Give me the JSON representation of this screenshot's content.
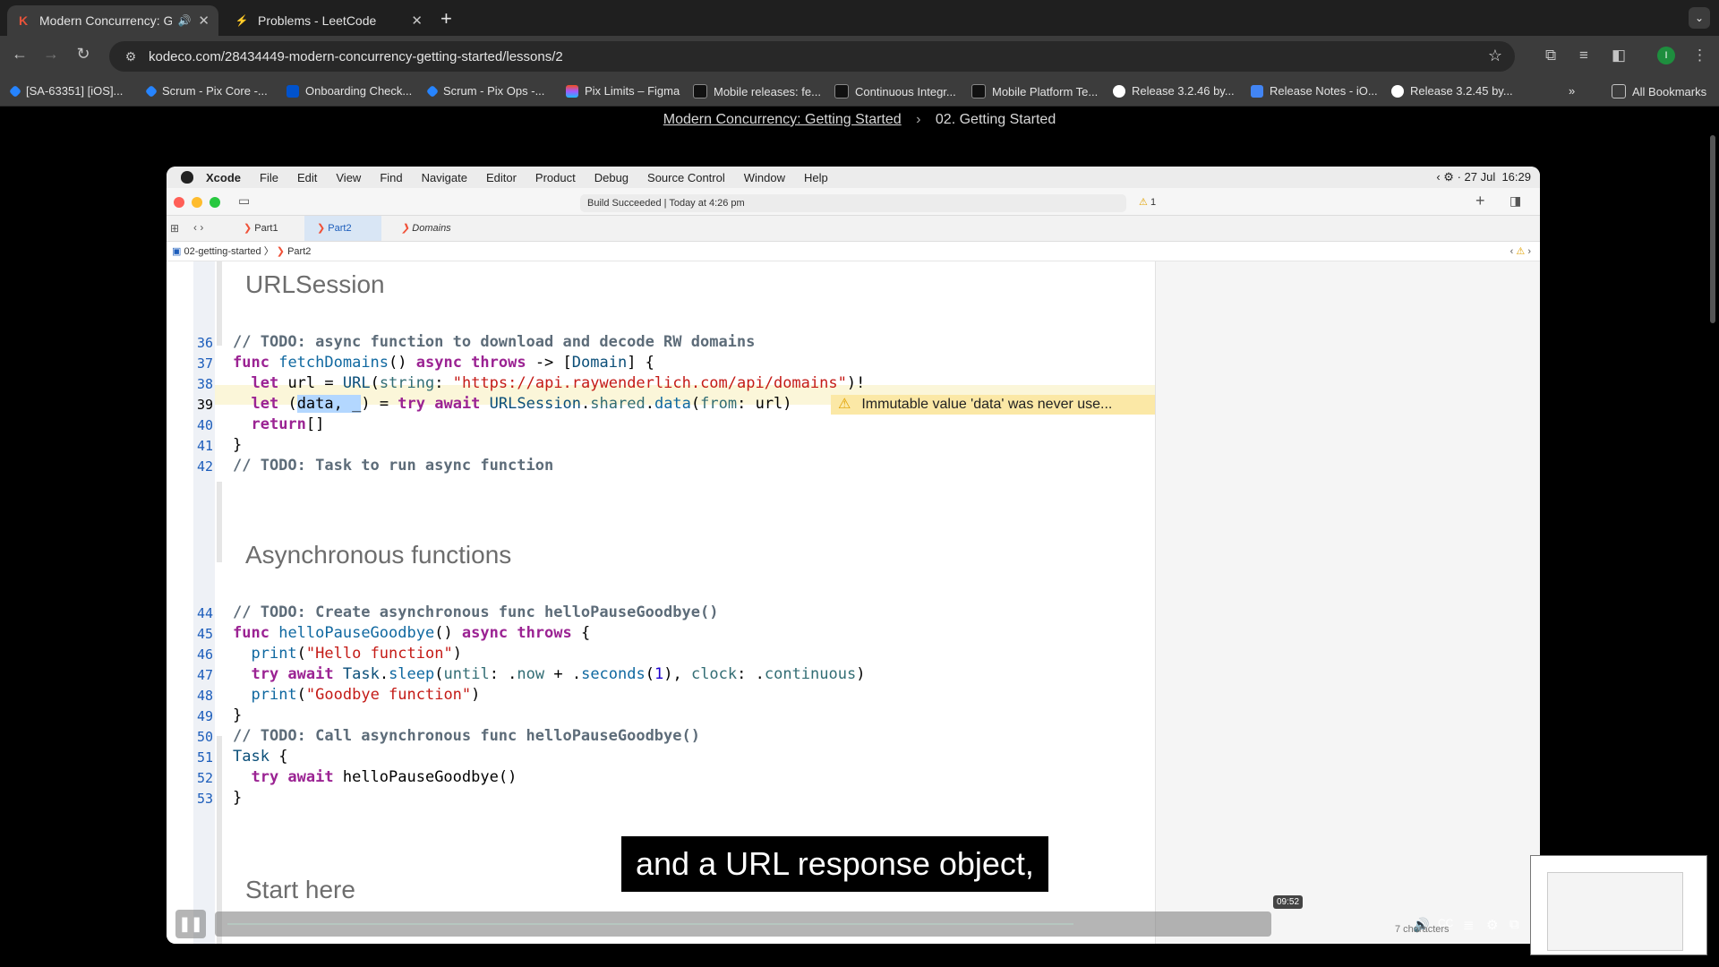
{
  "browser": {
    "tabs": [
      {
        "title": "Modern Concurrency: Getting Started",
        "favicon": "K"
      },
      {
        "title": "Problems - LeetCode",
        "favicon": "⚡"
      }
    ],
    "url": "kodeco.com/28434449-modern-concurrency-getting-started/lessons/2",
    "bookmarks": [
      "[SA-63351] [iOS]...",
      "Scrum - Pix Core -...",
      "Onboarding Check...",
      "Scrum - Pix Ops -...",
      "Pix Limits – Figma",
      "Mobile releases: fe...",
      "Continuous Integr...",
      "Mobile Platform Te...",
      "Release 3.2.46 by...",
      "Release Notes - iO...",
      "Release 3.2.45 by..."
    ],
    "all_bookmarks": "All Bookmarks",
    "profile_initial": "I"
  },
  "page": {
    "breadcrumb_course": "Modern Concurrency: Getting Started",
    "breadcrumb_lesson": "02. Getting Started"
  },
  "xcode": {
    "menu": [
      "Xcode",
      "File",
      "Edit",
      "View",
      "Find",
      "Navigate",
      "Editor",
      "Product",
      "Debug",
      "Source Control",
      "Window",
      "Help"
    ],
    "date": "27 Jul",
    "time": "16:29",
    "build_status": "Build Succeeded | Today at 4:26 pm",
    "warning_count": "1",
    "tabs": [
      "Part1",
      "Part2",
      "Domains"
    ],
    "jump_bar": [
      "02-getting-started",
      "Part2"
    ],
    "headings": [
      "URLSession",
      "Asynchronous functions",
      "Start here"
    ],
    "line_numbers": [
      "36",
      "37",
      "38",
      "39",
      "40",
      "41",
      "42",
      "44",
      "45",
      "46",
      "47",
      "48",
      "49",
      "50",
      "51",
      "52",
      "53"
    ],
    "warning_text": "Immutable value 'data' was never use..."
  },
  "video": {
    "caption": "and a URL response object,",
    "time_pill": "09:52",
    "chars_label": "7 characters",
    "progress": 0.82
  }
}
